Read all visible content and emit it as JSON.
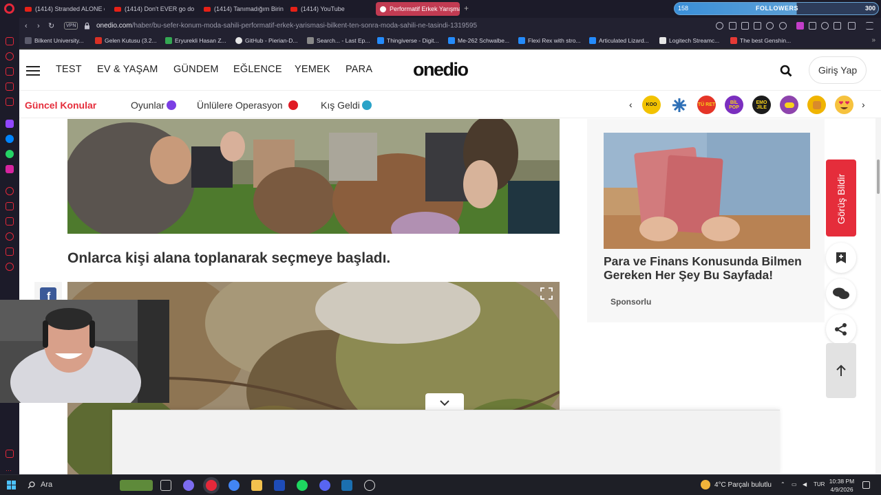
{
  "browser": {
    "tabs": [
      {
        "label": "(1414) Stranded ALONE on"
      },
      {
        "label": "(1414) Don't EVER go dow"
      },
      {
        "label": "(1414) Tanımadığım Birine"
      },
      {
        "label": "(1414) YouTube"
      },
      {
        "label": "Performatif Erkek Yarışma"
      }
    ],
    "new_tab": "+",
    "followers_widget": {
      "left_count": "158",
      "label": "FOLLOWERS",
      "right_count": "300"
    },
    "vpn_label": "VPN",
    "url_host": "onedio.com",
    "url_path": "/haber/bu-sefer-konum-moda-sahili-performatif-erkek-yarismasi-bilkent-ten-sonra-moda-sahili-ne-tasindi-1319595",
    "bookmarks": [
      {
        "label": "Bilkent University...",
        "color": "#5b5b6b"
      },
      {
        "label": "Gelen Kutusu (3.2...",
        "color": "#d93025"
      },
      {
        "label": "Eryurekli Hasan Z...",
        "color": "#34a853"
      },
      {
        "label": "GitHub - Pierian-D...",
        "color": "#e6e6e6"
      },
      {
        "label": "Search... - Last Ep...",
        "color": "#888888"
      },
      {
        "label": "Thingiverse - Digit...",
        "color": "#248bfb"
      },
      {
        "label": "Me-262 Schwalbe...",
        "color": "#248bfb"
      },
      {
        "label": "Flexi Rex with stro...",
        "color": "#248bfb"
      },
      {
        "label": "Articulated Lizard...",
        "color": "#248bfb"
      },
      {
        "label": "Logitech Streamc...",
        "color": "#e6e6e6"
      },
      {
        "label": "The best Genshin...",
        "color": "#e53935"
      }
    ]
  },
  "site": {
    "logo": "onedio",
    "nav": [
      "TEST",
      "EV & YAŞAM",
      "GÜNDEM",
      "EĞLENCE",
      "YEMEK",
      "PARA"
    ],
    "login": "Giriş Yap",
    "topics_title": "Güncel Konular",
    "topics": [
      {
        "label": "Oyunlar",
        "emoji_color": "#7b3fe4"
      },
      {
        "label": "Ünlülere Operasyon",
        "emoji_color": "#e01b24"
      },
      {
        "label": "Kış Geldi",
        "emoji_color": "#2aa3c8"
      }
    ],
    "badges": [
      {
        "label": "KOO",
        "color": "#f2c200"
      },
      {
        "label": "",
        "color": "#2d6fb6"
      },
      {
        "label": "TÜ RET",
        "color": "#e53528"
      },
      {
        "label": "BİL POP",
        "color": "#7b2fbf"
      },
      {
        "label": "EMO JİLE",
        "color": "#1c1c1c"
      },
      {
        "label": "",
        "color": "#8e44ad"
      },
      {
        "label": "",
        "color": "#f0b400"
      },
      {
        "label": "",
        "color": "#f6c23e"
      }
    ]
  },
  "article": {
    "heading": "Onlarca kişi alana toplanarak seçmeye başladı."
  },
  "sidebar_ad": {
    "title": "Para ve Finans Konusunda Bilmen Gereken Her Şey Bu Sayfada!",
    "sponsored": "Sponsorlu"
  },
  "feedback_label": "Görüş Bildir",
  "taskbar": {
    "search": "Ara",
    "weather": "4°C  Parçalı bulutlu",
    "lang": "TUR",
    "time": "10:38 PM",
    "date": "4/9/2026"
  },
  "colors": {
    "accent": "#e52d3b",
    "followers": "#3a8fd8",
    "active_tab": "#c23b52"
  }
}
